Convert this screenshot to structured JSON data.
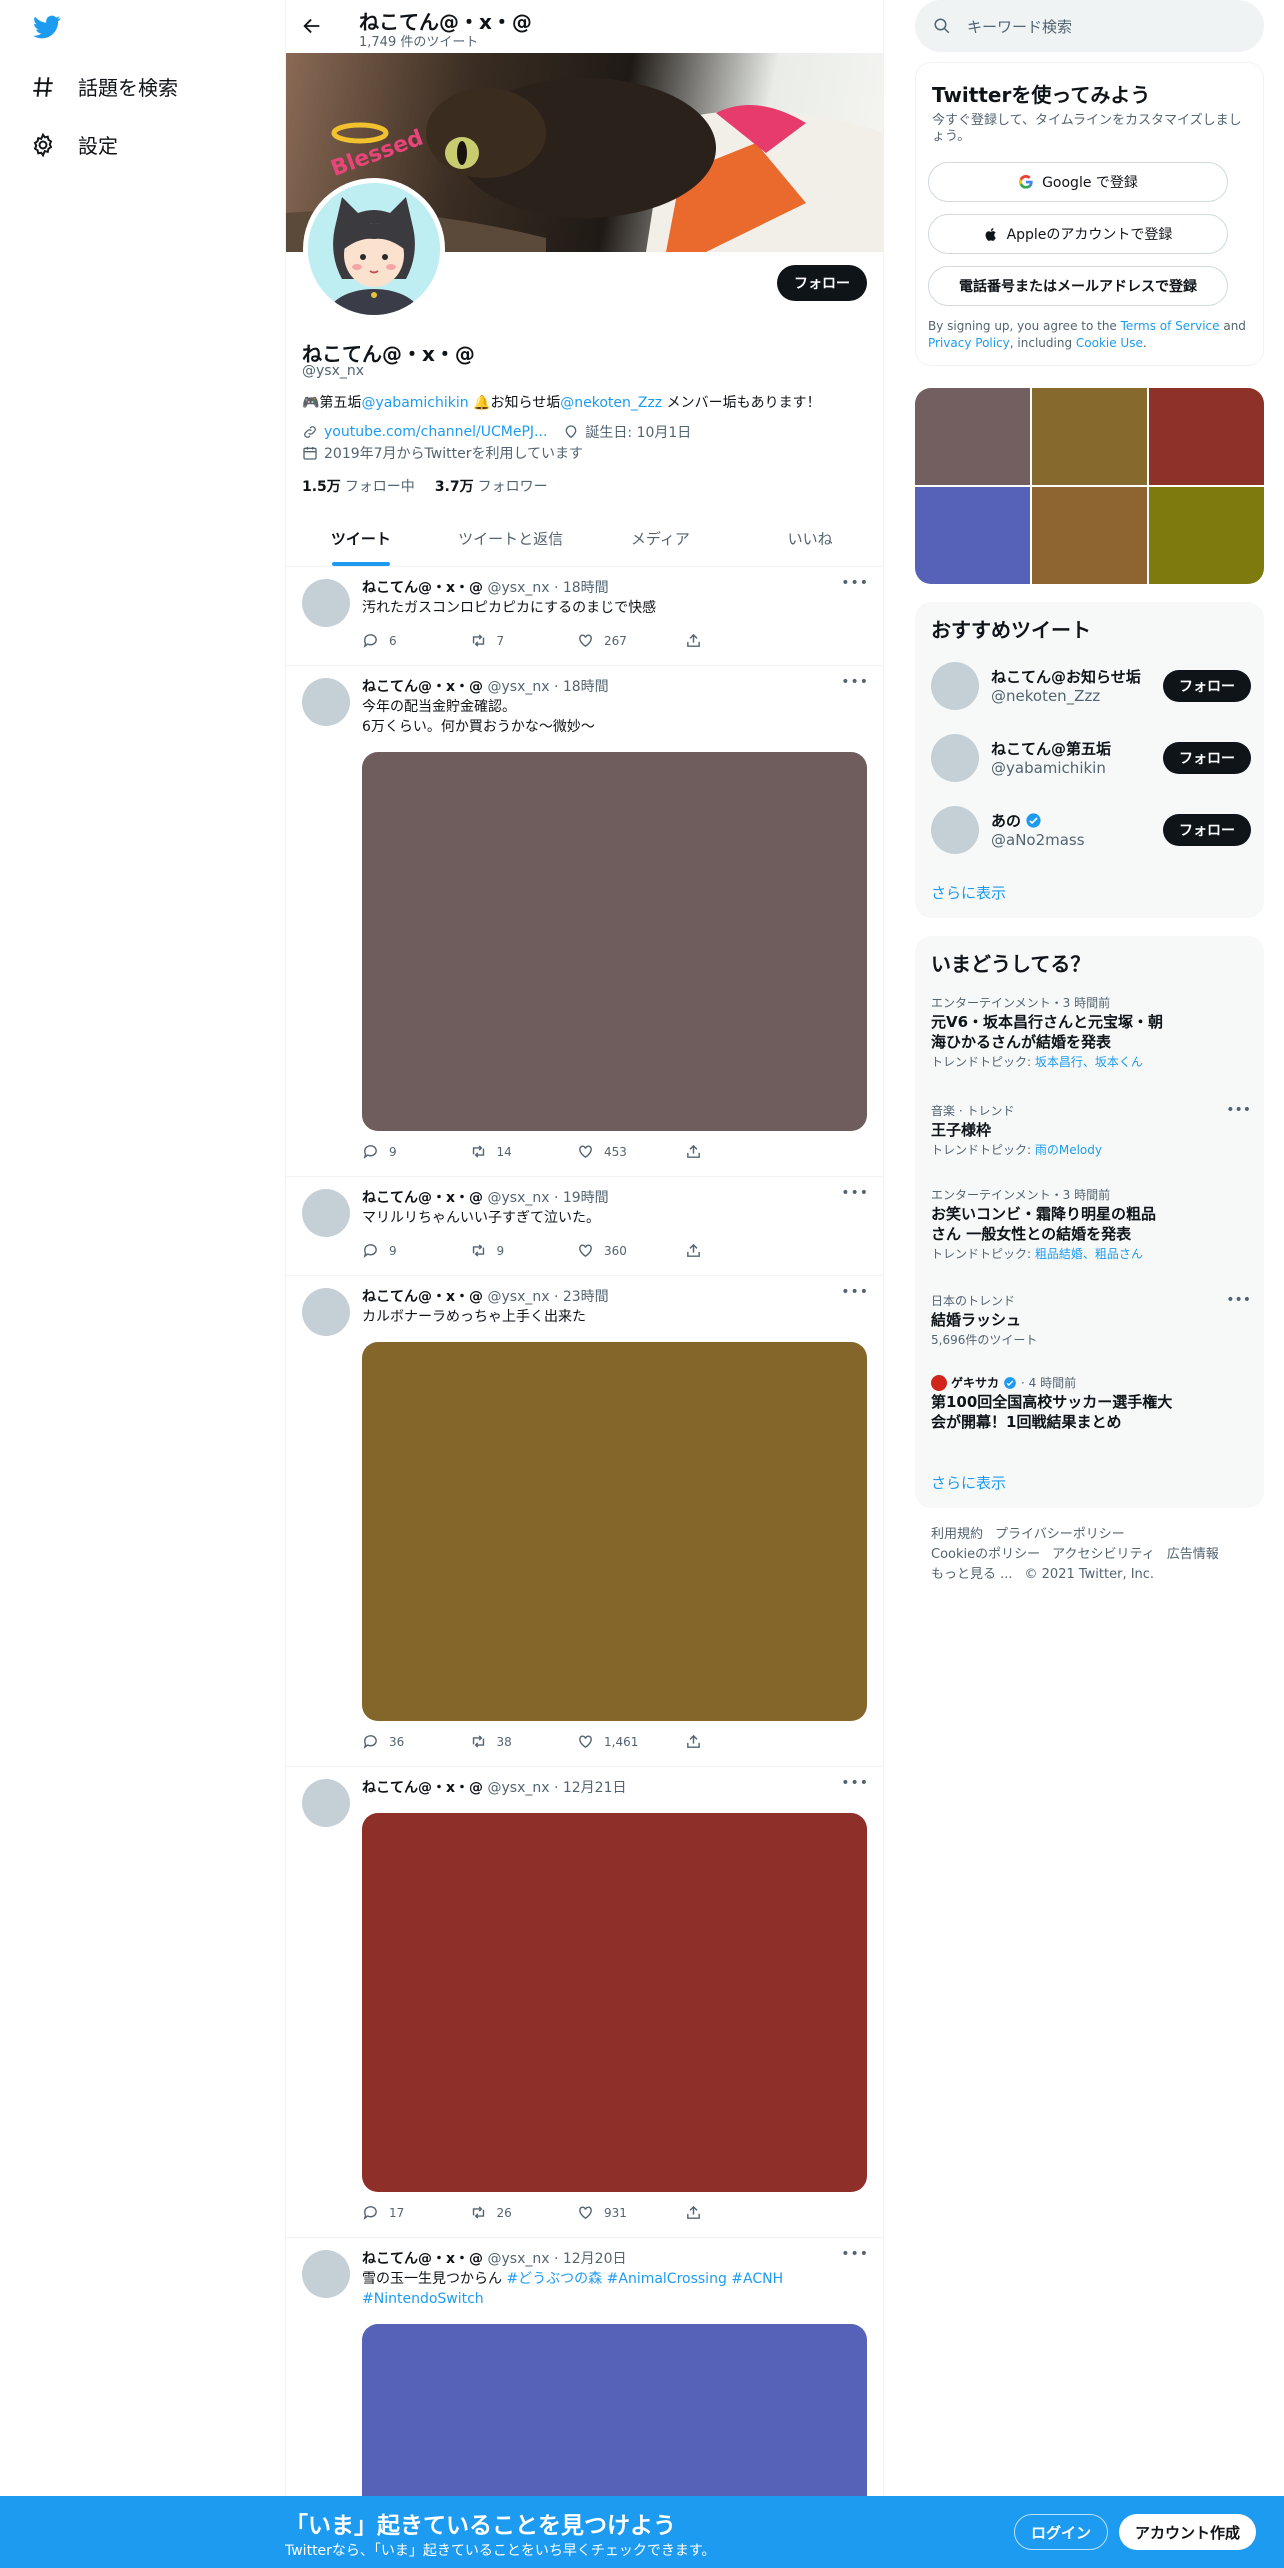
{
  "nav": {
    "search_label": "話題を検索",
    "settings_label": "設定"
  },
  "header": {
    "name": "ねこてん@・x・@",
    "tweet_count": "1,749 件のツイート"
  },
  "profile": {
    "name": "ねこてん@・x・@",
    "handle": "@ysx_nx",
    "follow_label": "フォロー",
    "bio_prefix": "🎮第五垢",
    "bio_link1": "@yabamichikin",
    "bio_mid": " 🔔お知らせ垢",
    "bio_link2": "@nekoten_Zzz",
    "bio_suffix": " メンバー垢もあります！",
    "website": "youtube.com/channel/UCMePJ...",
    "birthday": "誕生日: 10月1日",
    "joined": "2019年7月からTwitterを利用しています",
    "following_count": "1.5万",
    "following_label": "フォロー中",
    "followers_count": "3.7万",
    "followers_label": "フォロワー",
    "banner_text": "Blessed"
  },
  "tabs": [
    "ツイート",
    "ツイートと返信",
    "メディア",
    "いいね"
  ],
  "tweets": [
    {
      "name": "ねこてん@・x・@",
      "meta": "@ysx_nx · 18時間",
      "text": "汚れたガスコンロピカピカにするのまじで快感",
      "replies": "6",
      "retweets": "7",
      "likes": "267"
    },
    {
      "name": "ねこてん@・x・@",
      "meta": "@ysx_nx · 18時間",
      "text": "今年の配当金貯金確認。",
      "text2": "6万くらい。何か買おうかな〜微妙〜",
      "replies": "9",
      "retweets": "14",
      "likes": "453",
      "media_color": "#6f5c5c"
    },
    {
      "name": "ねこてん@・x・@",
      "meta": "@ysx_nx · 19時間",
      "text": "マリルリちゃんいい子すぎて泣いた。",
      "replies": "9",
      "retweets": "9",
      "likes": "360"
    },
    {
      "name": "ねこてん@・x・@",
      "meta": "@ysx_nx · 23時間",
      "text": "カルボナーラめっちゃ上手く出来た",
      "replies": "36",
      "retweets": "38",
      "likes": "1,461",
      "media_color": "#84662a"
    },
    {
      "name": "ねこてん@・x・@",
      "meta": "@ysx_nx · 12月21日",
      "replies": "17",
      "retweets": "26",
      "likes": "931",
      "media_color": "#8e3029"
    },
    {
      "name": "ねこてん@・x・@",
      "meta": "@ysx_nx · 12月20日",
      "text": "雪の玉一生見つからん ",
      "hashtags": "#どうぶつの森 #AnimalCrossing #ACNH",
      "hashtags2": "#NintendoSwitch",
      "media_color": "#5562b7"
    }
  ],
  "search": {
    "placeholder": "キーワード検索"
  },
  "signup": {
    "title": "Twitterを使ってみよう",
    "subtitle": "今すぐ登録して、タイムラインをカスタマイズしましょう。",
    "google_label": "Google で登録",
    "apple_label": "Appleのアカウントで登録",
    "phone_label": "電話番号またはメールアドレスで登録",
    "fine_1": "By signing up, you agree to the ",
    "terms": "Terms of Service",
    "fine_2": " and ",
    "privacy": "Privacy Policy",
    "fine_3": ", including ",
    "cookie": "Cookie Use",
    "fine_4": "."
  },
  "media_grid": {
    "colors": [
      "#735f5f",
      "#86692c",
      "#8e3129",
      "#5662b7",
      "#8e6431",
      "#7e7a0e"
    ]
  },
  "who_to_follow": {
    "title": "おすすめツイート",
    "users": [
      {
        "name": "ねこてん@お知らせ垢",
        "handle": "@nekoten_Zzz",
        "follow_label": "フォロー"
      },
      {
        "name": "ねこてん@第五垢",
        "handle": "@yabamichikin",
        "follow_label": "フォロー"
      },
      {
        "name": "あの",
        "handle": "@aNo2mass",
        "follow_label": "フォロー",
        "verified": true
      }
    ],
    "more": "さらに表示"
  },
  "trends": {
    "title": "いまどうしてる？",
    "items": [
      {
        "category": "エンターテインメント・3 時間前",
        "name": "元V6・坂本昌行さんと元宝塚・朝",
        "name2": "海ひかるさんが結婚を発表",
        "sub_prefix": "トレンドトピック: ",
        "sub_links": "坂本昌行、坂本くん"
      },
      {
        "category": "音楽 · トレンド",
        "name": "王子様枠",
        "sub_prefix": "トレンドトピック: ",
        "sub_links": "雨のMelody"
      },
      {
        "category": "エンターテインメント・3 時間前",
        "name": "お笑いコンビ・霜降り明星の粗品",
        "name2": "さん 一般女性との結婚を発表",
        "sub_prefix": "トレンドトピック: ",
        "sub_links": "粗品結婚、粗品さん"
      },
      {
        "category": "日本のトレンド",
        "name": "結婚ラッシュ",
        "sub": "5,696件のツイート"
      },
      {
        "category": "ゲキサカ",
        "category_time": "· 4 時間前",
        "name": "第100回全国高校サッカー選手権大",
        "name2": "会が開幕！1回戦結果まとめ"
      }
    ],
    "more": "さらに表示"
  },
  "footer": {
    "links1": [
      "利用規約",
      "プライバシーポリシー"
    ],
    "links2": [
      "Cookieのポリシー",
      "アクセシビリティ",
      "広告情報"
    ],
    "more": "もっと見る ...",
    "copyright": "© 2021 Twitter, Inc."
  },
  "bottom_bar": {
    "title": "「いま」起きていることを見つけよう",
    "subtitle": "Twitterなら、「いま」起きていることをいち早くチェックできます。",
    "login_label": "ログイン",
    "signup_label": "アカウント作成"
  },
  "colors": {
    "accent": "#1d9bf0",
    "dark": "#0f1419",
    "muted": "#536471"
  }
}
